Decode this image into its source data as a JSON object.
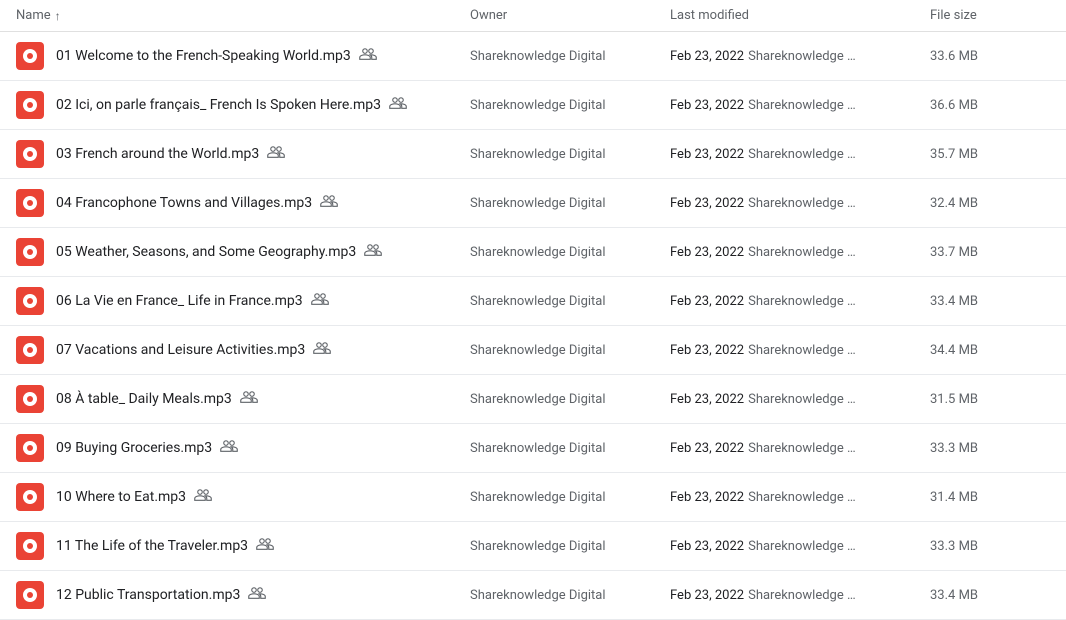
{
  "header": {
    "name_label": "Name",
    "owner_label": "Owner",
    "modified_label": "Last modified",
    "size_label": "File size"
  },
  "files": [
    {
      "name": "01 Welcome to the French-Speaking World.mp3",
      "owner": "Shareknowledge Digital",
      "modified_date": "Feb 23, 2022",
      "modified_owner": "Shareknowledge …",
      "size": "33.6 MB"
    },
    {
      "name": "02 Ici, on parle français_ French Is Spoken Here.mp3",
      "owner": "Shareknowledge Digital",
      "modified_date": "Feb 23, 2022",
      "modified_owner": "Shareknowledge …",
      "size": "36.6 MB"
    },
    {
      "name": "03 French around the World.mp3",
      "owner": "Shareknowledge Digital",
      "modified_date": "Feb 23, 2022",
      "modified_owner": "Shareknowledge …",
      "size": "35.7 MB"
    },
    {
      "name": "04 Francophone Towns and Villages.mp3",
      "owner": "Shareknowledge Digital",
      "modified_date": "Feb 23, 2022",
      "modified_owner": "Shareknowledge …",
      "size": "32.4 MB"
    },
    {
      "name": "05 Weather, Seasons, and Some Geography.mp3",
      "owner": "Shareknowledge Digital",
      "modified_date": "Feb 23, 2022",
      "modified_owner": "Shareknowledge …",
      "size": "33.7 MB"
    },
    {
      "name": "06 La Vie en France_ Life in France.mp3",
      "owner": "Shareknowledge Digital",
      "modified_date": "Feb 23, 2022",
      "modified_owner": "Shareknowledge …",
      "size": "33.4 MB"
    },
    {
      "name": "07 Vacations and Leisure Activities.mp3",
      "owner": "Shareknowledge Digital",
      "modified_date": "Feb 23, 2022",
      "modified_owner": "Shareknowledge …",
      "size": "34.4 MB"
    },
    {
      "name": "08 À table_ Daily Meals.mp3",
      "owner": "Shareknowledge Digital",
      "modified_date": "Feb 23, 2022",
      "modified_owner": "Shareknowledge …",
      "size": "31.5 MB"
    },
    {
      "name": "09 Buying Groceries.mp3",
      "owner": "Shareknowledge Digital",
      "modified_date": "Feb 23, 2022",
      "modified_owner": "Shareknowledge …",
      "size": "33.3 MB"
    },
    {
      "name": "10 Where to Eat.mp3",
      "owner": "Shareknowledge Digital",
      "modified_date": "Feb 23, 2022",
      "modified_owner": "Shareknowledge …",
      "size": "31.4 MB"
    },
    {
      "name": "11 The Life of the Traveler.mp3",
      "owner": "Shareknowledge Digital",
      "modified_date": "Feb 23, 2022",
      "modified_owner": "Shareknowledge …",
      "size": "33.3 MB"
    },
    {
      "name": "12 Public Transportation.mp3",
      "owner": "Shareknowledge Digital",
      "modified_date": "Feb 23, 2022",
      "modified_owner": "Shareknowledge …",
      "size": "33.4 MB"
    }
  ]
}
